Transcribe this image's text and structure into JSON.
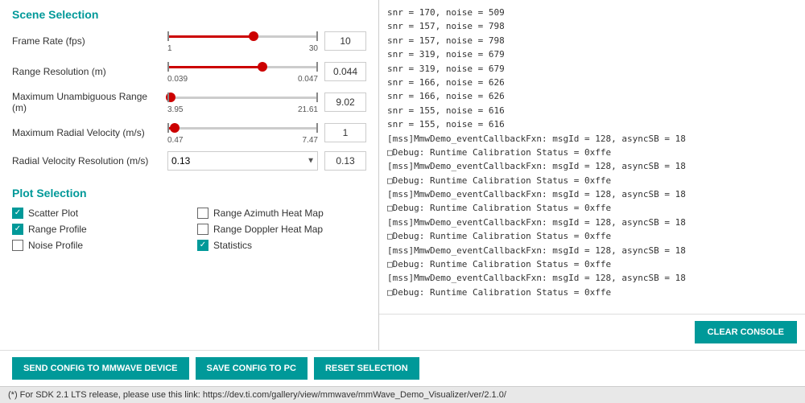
{
  "left_panel": {
    "scene_section_title": "Scene Selection",
    "params": [
      {
        "label": "Frame Rate (fps)",
        "slider_min": "1",
        "slider_max": "30",
        "slider_pct": 57,
        "value": "10",
        "type": "slider"
      },
      {
        "label": "Range Resolution (m)",
        "slider_min": "0.039",
        "slider_max": "0.047",
        "slider_pct": 63,
        "value": "0.044",
        "type": "slider"
      },
      {
        "label": "Maximum Unambiguous Range (m)",
        "slider_min": "3.95",
        "slider_max": "21.61",
        "slider_pct": 2,
        "value": "9.02",
        "type": "slider"
      },
      {
        "label": "Maximum Radial Velocity (m/s)",
        "slider_min": "0.47",
        "slider_max": "7.47",
        "slider_pct": 5,
        "value": "1",
        "type": "slider"
      },
      {
        "label": "Radial Velocity Resolution (m/s)",
        "dropdown_value": "0.13",
        "value": "0.13",
        "type": "dropdown"
      }
    ],
    "plot_section_title": "Plot Selection",
    "plots": [
      {
        "label": "Scatter Plot",
        "checked": true,
        "col": 0
      },
      {
        "label": "Range Azimuth Heat Map",
        "checked": false,
        "col": 1
      },
      {
        "label": "Range Profile",
        "checked": true,
        "col": 0
      },
      {
        "label": "Range Doppler Heat Map",
        "checked": false,
        "col": 1
      },
      {
        "label": "Noise Profile",
        "checked": false,
        "col": 0
      },
      {
        "label": "Statistics",
        "checked": true,
        "col": 1
      }
    ],
    "buttons": {
      "send": "SEND CONFIG TO MMWAVE DEVICE",
      "save": "SAVE CONFIG TO PC",
      "reset": "RESET SELECTION"
    }
  },
  "console": {
    "lines": [
      "snr = 170, noise = 509",
      "snr = 157, noise = 798",
      "snr = 157, noise = 798",
      "snr = 319, noise = 679",
      "snr = 319, noise = 679",
      "snr = 166, noise = 626",
      "snr = 166, noise = 626",
      "snr = 155, noise = 616",
      "snr = 155, noise = 616",
      "[mss]MmwDemo_eventCallbackFxn: msgId = 128, asyncSB = 18",
      "□Debug: Runtime Calibration Status = 0xffe",
      "[mss]MmwDemo_eventCallbackFxn: msgId = 128, asyncSB = 18",
      "□Debug: Runtime Calibration Status = 0xffe",
      "[mss]MmwDemo_eventCallbackFxn: msgId = 128, asyncSB = 18",
      "□Debug: Runtime Calibration Status = 0xffe",
      "[mss]MmwDemo_eventCallbackFxn: msgId = 128, asyncSB = 18",
      "□Debug: Runtime Calibration Status = 0xffe",
      "[mss]MmwDemo_eventCallbackFxn: msgId = 128, asyncSB = 18",
      "□Debug: Runtime Calibration Status = 0xffe",
      "[mss]MmwDemo_eventCallbackFxn: msgId = 128, asyncSB = 18",
      "□Debug: Runtime Calibration Status = 0xffe"
    ],
    "clear_button": "CLEAR CONSOLE"
  },
  "status_bar": {
    "text": "(*) For SDK 2.1 LTS release, please use this link: https://dev.ti.com/gallery/view/mmwave/mmWave_Demo_Visualizer/ver/2.1.0/"
  }
}
